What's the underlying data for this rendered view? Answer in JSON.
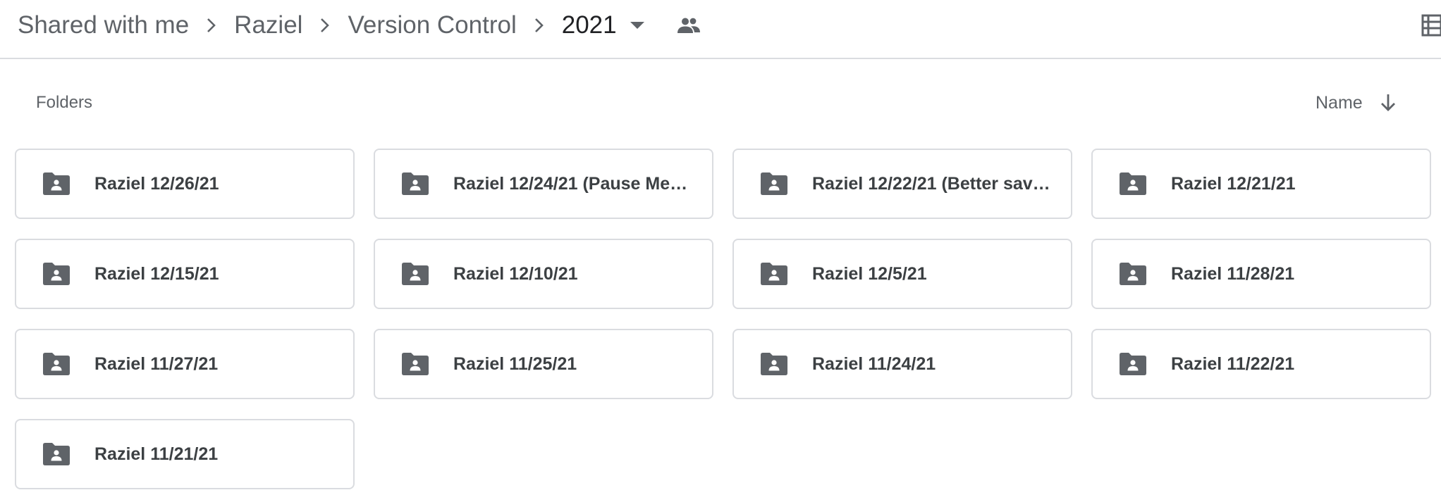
{
  "breadcrumb": {
    "items": [
      "Shared with me",
      "Raziel",
      "Version Control"
    ],
    "current": "2021"
  },
  "icons": {
    "separator": "chevron-right-icon",
    "dropdown": "arrow-drop-down-icon",
    "shared": "people-icon",
    "view_toggle": "list-view-icon",
    "sort_direction": "arrow-down-icon",
    "folder": "shared-folder-icon"
  },
  "section": {
    "label": "Folders"
  },
  "sort": {
    "label": "Name",
    "direction": "descending"
  },
  "folders": [
    {
      "name": "Raziel 12/26/21"
    },
    {
      "name": "Raziel 12/24/21 (Pause Me…"
    },
    {
      "name": "Raziel 12/22/21 (Better sav…"
    },
    {
      "name": "Raziel 12/21/21"
    },
    {
      "name": "Raziel 12/15/21"
    },
    {
      "name": "Raziel 12/10/21"
    },
    {
      "name": "Raziel 12/5/21"
    },
    {
      "name": "Raziel 11/28/21"
    },
    {
      "name": "Raziel 11/27/21"
    },
    {
      "name": "Raziel 11/25/21"
    },
    {
      "name": "Raziel 11/24/21"
    },
    {
      "name": "Raziel 11/22/21"
    },
    {
      "name": "Raziel 11/21/21"
    }
  ],
  "colors": {
    "icon": "#5f6368",
    "text": "#3c4043",
    "border": "#dadce0"
  }
}
